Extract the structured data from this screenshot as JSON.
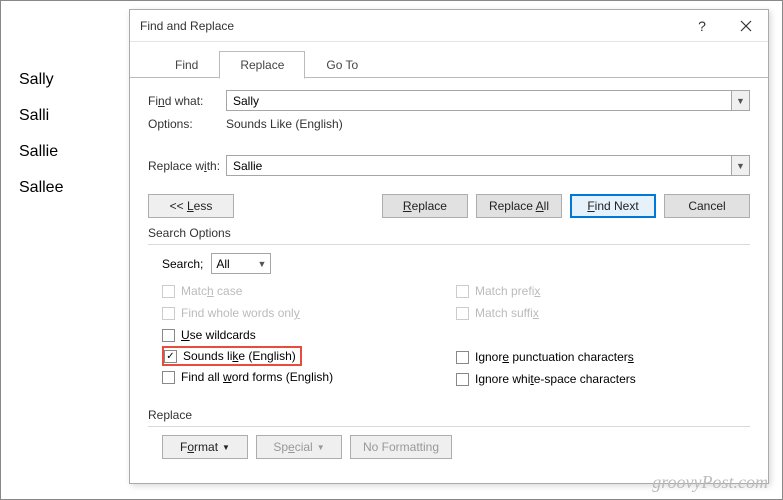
{
  "document": {
    "lines": [
      "Sally",
      "Salli",
      "Sallie",
      "Sallee"
    ]
  },
  "dialog": {
    "title": "Find and Replace",
    "help": "?",
    "tabs": {
      "find": "Find",
      "replace": "Replace",
      "goto": "Go To"
    },
    "find_what_label": "Find what:",
    "find_what_value": "Sally",
    "options_label": "Options:",
    "options_value": "Sounds Like (English)",
    "replace_with_label": "Replace with:",
    "replace_with_value": "Sallie",
    "buttons": {
      "less": "<< Less",
      "replace": "Replace",
      "replace_all": "Replace All",
      "find_next": "Find Next",
      "cancel": "Cancel"
    },
    "search_options_label": "Search Options",
    "search_label": "Search:",
    "search_value": "All",
    "checks": {
      "match_case": "Match case",
      "whole_words": "Find whole words only",
      "wildcards": "Use wildcards",
      "sounds_like": "Sounds like (English)",
      "word_forms": "Find all word forms (English)",
      "prefix": "Match prefix",
      "suffix": "Match suffix",
      "ign_punct": "Ignore punctuation characters",
      "ign_ws": "Ignore white-space characters"
    },
    "replace_section": "Replace",
    "format_btn": "Format",
    "special_btn": "Special",
    "no_formatting_btn": "No Formatting"
  },
  "watermark": "groovyPost.com"
}
